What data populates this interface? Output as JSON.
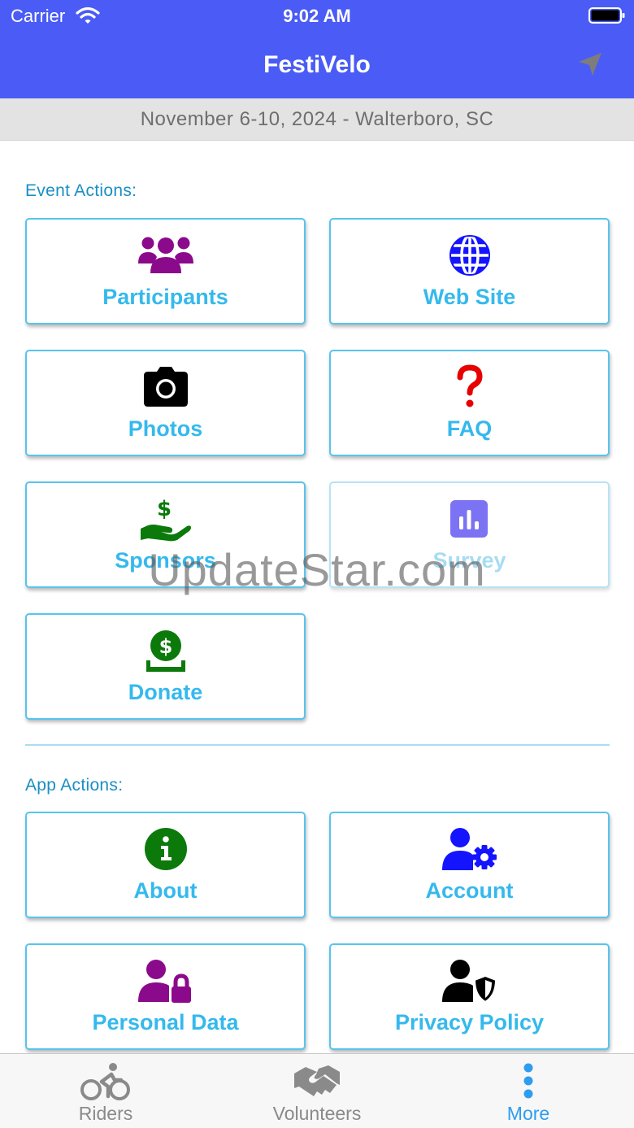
{
  "status_bar": {
    "carrier": "Carrier",
    "time": "9:02 AM"
  },
  "nav": {
    "title": "FestiVelo",
    "action_icon": "location-arrow-icon"
  },
  "event_info": "November 6-10, 2024 - Walterboro, SC",
  "event_section": {
    "title": "Event Actions:",
    "items": [
      {
        "label": "Participants",
        "icon": "users-icon",
        "color": "#8b0a8b"
      },
      {
        "label": "Web Site",
        "icon": "globe-icon",
        "color": "#1414ff"
      },
      {
        "label": "Photos",
        "icon": "camera-icon",
        "color": "#000000"
      },
      {
        "label": "FAQ",
        "icon": "question-mark-icon",
        "color": "#e60000"
      },
      {
        "label": "Sponsors",
        "icon": "hand-dollar-icon",
        "color": "#0b7a0b"
      },
      {
        "label": "Survey",
        "icon": "poll-chart-icon",
        "color": "#4a3cf0"
      },
      {
        "label": "Donate",
        "icon": "coin-dollar-icon",
        "color": "#0b7a0b"
      }
    ]
  },
  "app_section": {
    "title": "App Actions:",
    "items": [
      {
        "label": "About",
        "icon": "info-circle-icon",
        "color": "#0b7a0b"
      },
      {
        "label": "Account",
        "icon": "user-gear-icon",
        "color": "#1414ff"
      },
      {
        "label": "Personal Data",
        "icon": "user-lock-icon",
        "color": "#8b0a8b"
      },
      {
        "label": "Privacy Policy",
        "icon": "user-shield-icon",
        "color": "#000000"
      }
    ]
  },
  "watermark": "UpdateStar.com",
  "tab_bar": {
    "tabs": [
      {
        "label": "Riders",
        "icon": "bicycle-rider-icon"
      },
      {
        "label": "Volunteers",
        "icon": "handshake-icon"
      },
      {
        "label": "More",
        "icon": "more-dots-icon",
        "active": true
      }
    ],
    "active_color": "#2e9df0"
  }
}
